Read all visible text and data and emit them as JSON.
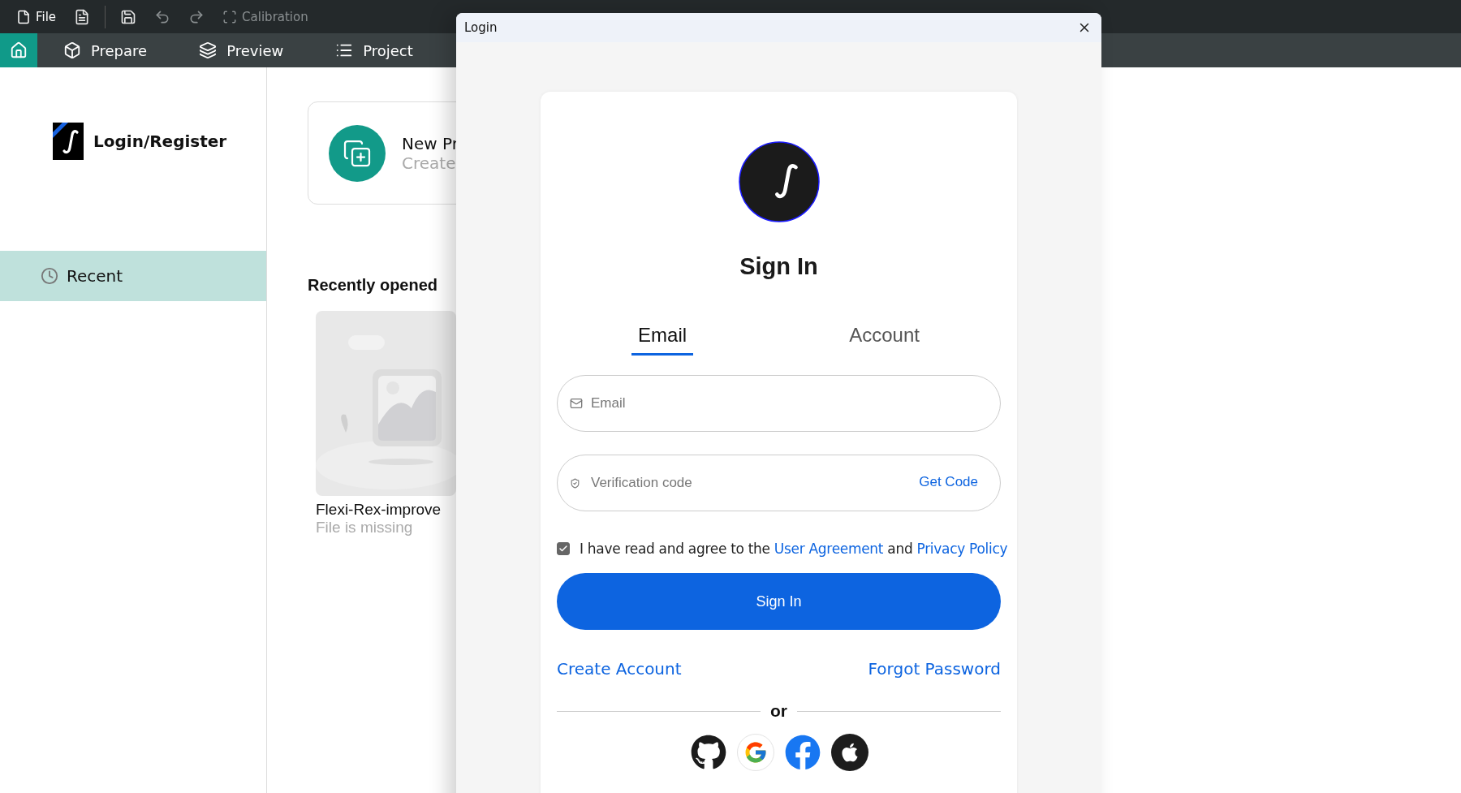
{
  "toolbar": {
    "file_menu": "File",
    "calibration": {
      "label": "Calibration",
      "disabled": true
    }
  },
  "nav_tabs": [
    {
      "kind": "home",
      "selected": true
    },
    {
      "kind": "prepare",
      "label": "Prepare",
      "selected": false
    },
    {
      "kind": "preview",
      "label": "Preview",
      "selected": false
    },
    {
      "kind": "project",
      "label": "Project",
      "selected": false
    }
  ],
  "sidebar": {
    "account": "Login/Register",
    "items": [
      {
        "label": "Recent",
        "selected": true
      }
    ]
  },
  "new_project": {
    "title": "New Pr",
    "subtitle": "Create"
  },
  "recent": {
    "heading": "Recently opened",
    "files": [
      {
        "name": "Flexi-Rex-improve",
        "status": "File is missing",
        "kind": "picture"
      }
    ]
  },
  "dialog": {
    "title": "Login",
    "heading": "Sign In",
    "tabs": [
      {
        "label": "Email",
        "selected": true
      },
      {
        "label": "Account",
        "selected": false
      }
    ],
    "email_field": {
      "placeholder": "Email"
    },
    "code_field": {
      "placeholder": "Verification code",
      "action": "Get Code"
    },
    "agreement": {
      "checked": true,
      "text": "I have read and agree to the",
      "user_agreement": "User Agreement",
      "conjunction": "and",
      "privacy_policy": "Privacy Policy"
    },
    "submit": "Sign In",
    "create_account": "Create Account",
    "forgot_password": "Forgot Password",
    "divider": "or",
    "providers": [
      {
        "kind": "github"
      },
      {
        "kind": "google"
      },
      {
        "kind": "facebook"
      },
      {
        "kind": "apple"
      }
    ]
  }
}
